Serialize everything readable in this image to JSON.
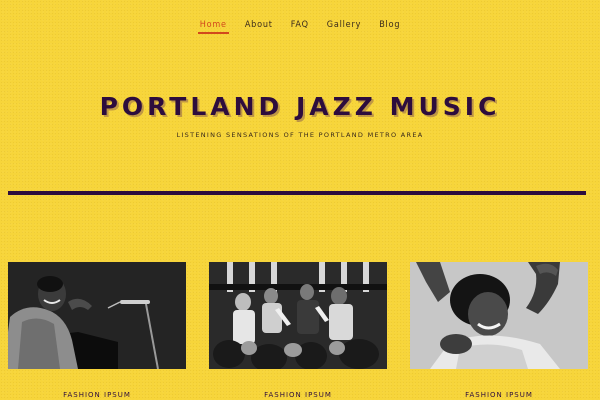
{
  "nav": {
    "items": [
      {
        "label": "Home"
      },
      {
        "label": "About"
      },
      {
        "label": "FAQ"
      },
      {
        "label": "Gallery"
      },
      {
        "label": "Blog"
      }
    ],
    "active": "Home"
  },
  "header": {
    "title": "PORTLAND JAZZ MUSIC",
    "subtitle": "LISTENING SENSATIONS OF THE PORTLAND METRO AREA"
  },
  "cards": [
    {
      "label": "FASHION IPSUM"
    },
    {
      "label": "FASHION IPSUM"
    },
    {
      "label": "FASHION IPSUM"
    }
  ],
  "colors": {
    "background": "#f7d53a",
    "accent": "#d2491c",
    "title": "#2d0d3d"
  }
}
